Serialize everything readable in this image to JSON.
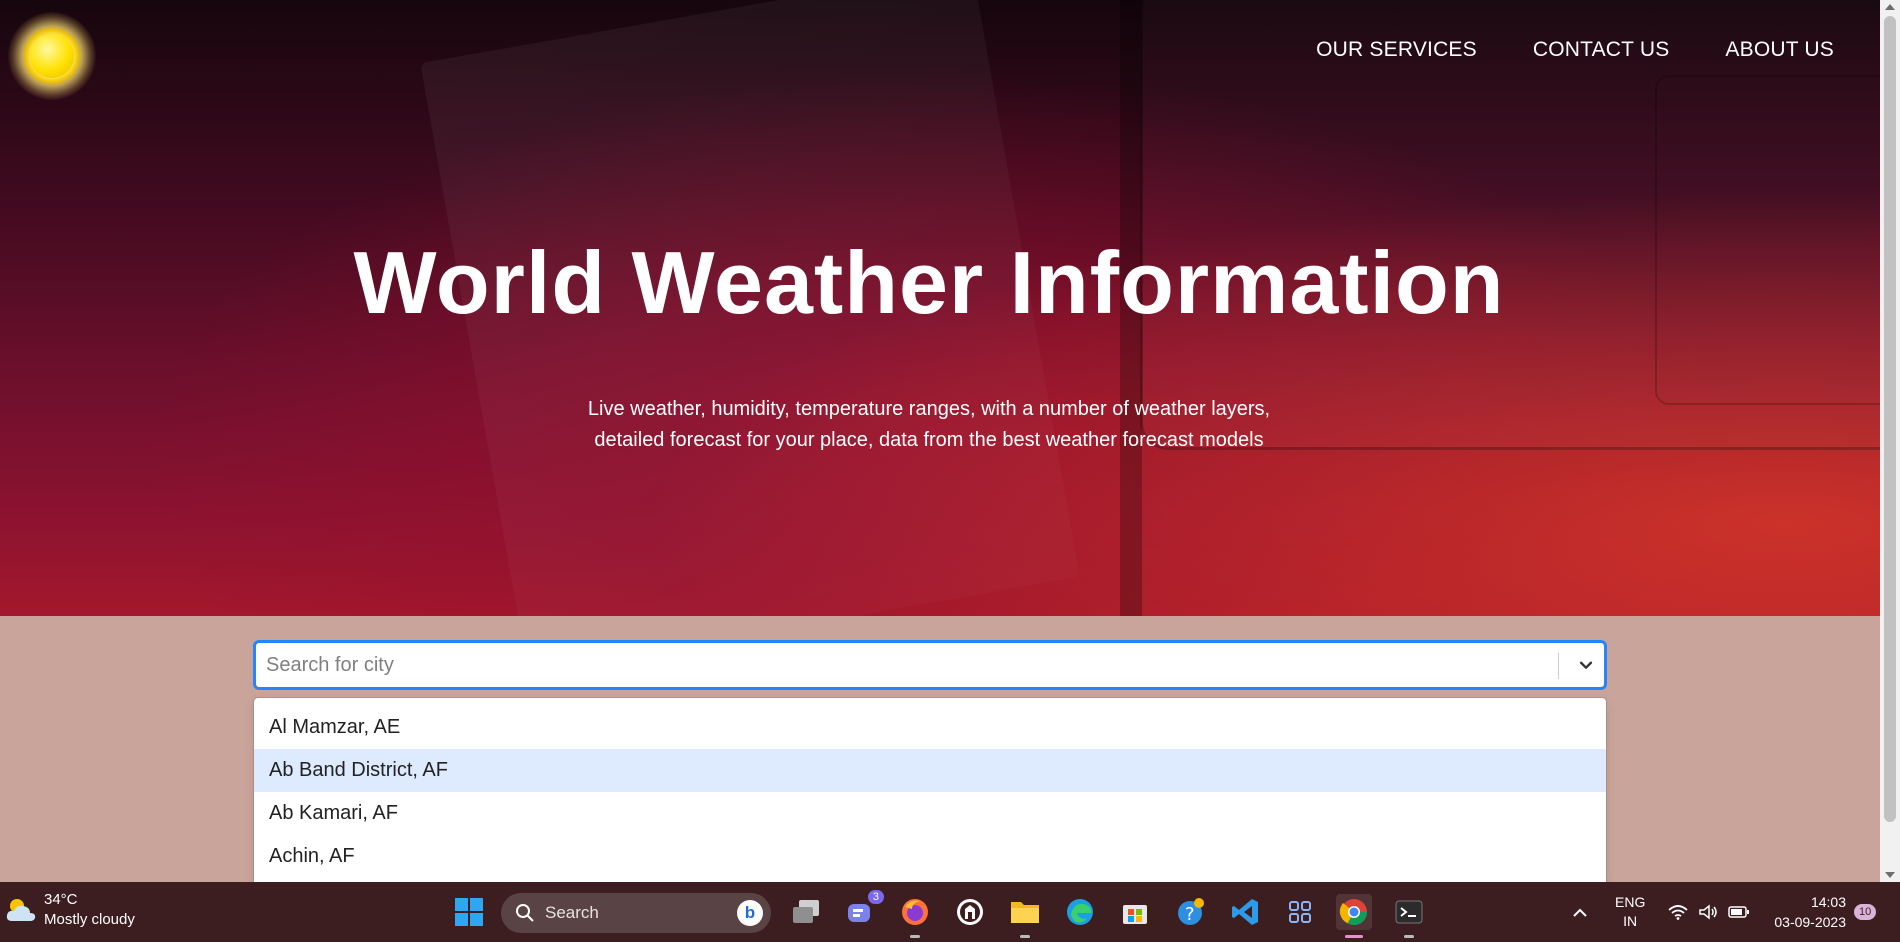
{
  "nav": {
    "services": "OUR SERVICES",
    "contact": "CONTACT US",
    "about": "ABOUT US"
  },
  "hero": {
    "title": "World Weather Information",
    "subtitle_line1": "Live weather, humidity, temperature ranges, with a number of weather layers,",
    "subtitle_line2": "detailed forecast for your place, data from the best weather forecast models"
  },
  "search": {
    "placeholder": "Search for city",
    "value": "",
    "options": [
      "Al Mamzar, AE",
      "Ab Band District, AF",
      "Ab Kamari, AF",
      "Achin, AF"
    ],
    "focused_index": 1
  },
  "taskbar": {
    "weather_temp": "34°C",
    "weather_desc": "Mostly cloudy",
    "search_label": "Search",
    "teams_badge": "3",
    "lang_top": "ENG",
    "lang_bottom": "IN",
    "time": "14:03",
    "date": "03-09-2023",
    "notifications": "10"
  },
  "colors": {
    "accent": "#2684ff",
    "option_focus": "#deebff",
    "taskbar": "#3d1e20",
    "page_bg": "#c9a49b"
  }
}
